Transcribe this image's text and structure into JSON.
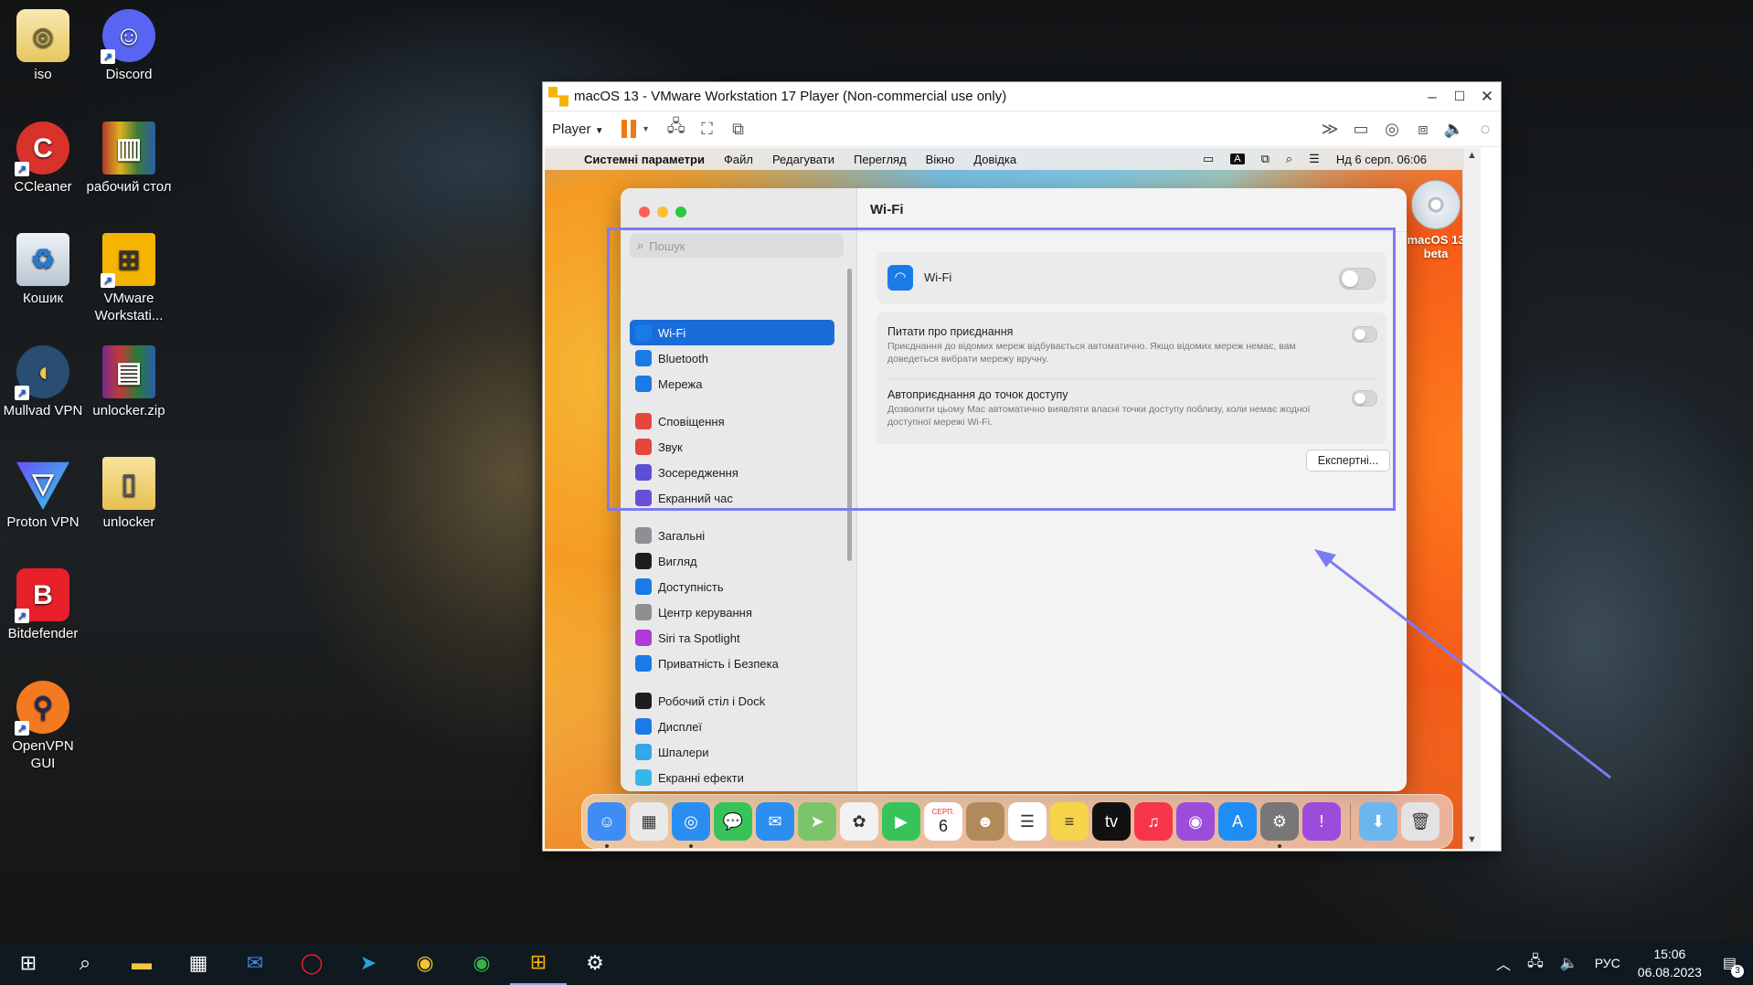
{
  "desktop": {
    "icons": [
      {
        "label": "iso",
        "icon": "iso-file-icon"
      },
      {
        "label": "Discord",
        "icon": "discord-icon"
      },
      {
        "label": "CCleaner",
        "icon": "ccleaner-icon"
      },
      {
        "label": "рабочий стол",
        "icon": "archive-icon"
      },
      {
        "label": "Кошик",
        "icon": "recycle-bin-icon"
      },
      {
        "label": "VMware Workstati...",
        "icon": "vmware-icon"
      },
      {
        "label": "Mullvad VPN",
        "icon": "mullvad-icon"
      },
      {
        "label": "unlocker.zip",
        "icon": "winrar-icon"
      },
      {
        "label": "Proton VPN",
        "icon": "proton-vpn-icon"
      },
      {
        "label": "unlocker",
        "icon": "folder-icon"
      },
      {
        "label": "Bitdefender",
        "icon": "bitdefender-icon"
      },
      {
        "label": "OpenVPN GUI",
        "icon": "openvpn-icon"
      }
    ]
  },
  "vmware": {
    "title": "macOS 13 - VMware Workstation 17 Player (Non-commercial use only)",
    "player_menu": "Player",
    "controls": {
      "minimize": "–",
      "maximize": "☐",
      "close": "✕"
    }
  },
  "macos": {
    "menubar": {
      "app": "Системні параметри",
      "items": [
        "Файл",
        "Редагувати",
        "Перегляд",
        "Вікно",
        "Довідка"
      ],
      "input_badge": "A",
      "datetime": "Нд 6 серп.  06:06"
    },
    "dvd_label": "macOS 13 beta",
    "settings": {
      "search_placeholder": "Пошук",
      "title": "Wi-Fi",
      "sidebar": [
        {
          "label": "Wi-Fi",
          "icon": "wifi-icon",
          "color": "#1a7be8",
          "selected": true
        },
        {
          "label": "Bluetooth",
          "icon": "bluetooth-icon",
          "color": "#1a7be8"
        },
        {
          "label": "Мережа",
          "icon": "globe-icon",
          "color": "#1a7be8"
        },
        {
          "gap": true
        },
        {
          "label": "Сповіщення",
          "icon": "bell-icon",
          "color": "#e8453c"
        },
        {
          "label": "Звук",
          "icon": "speaker-icon",
          "color": "#e8453c"
        },
        {
          "label": "Зосередження",
          "icon": "moon-icon",
          "color": "#5b4fd6"
        },
        {
          "label": "Екранний час",
          "icon": "hourglass-icon",
          "color": "#6a4fd6"
        },
        {
          "gap": true
        },
        {
          "label": "Загальні",
          "icon": "gear-icon",
          "color": "#8e8e93"
        },
        {
          "label": "Вигляд",
          "icon": "appearance-icon",
          "color": "#1d1d1f"
        },
        {
          "label": "Доступність",
          "icon": "accessibility-icon",
          "color": "#1a7be8"
        },
        {
          "label": "Центр керування",
          "icon": "control-center-icon",
          "color": "#8e8e93"
        },
        {
          "label": "Siri та Spotlight",
          "icon": "siri-icon",
          "color": "#b03ad6"
        },
        {
          "label": "Приватність і Безпека",
          "icon": "hand-icon",
          "color": "#1a7be8"
        },
        {
          "gap": true
        },
        {
          "label": "Робочий стіл і Dock",
          "icon": "dock-icon",
          "color": "#1d1d1f"
        },
        {
          "label": "Дисплеї",
          "icon": "display-icon",
          "color": "#1a7be8"
        },
        {
          "label": "Шпалери",
          "icon": "wallpaper-icon",
          "color": "#35a6e8"
        },
        {
          "label": "Екранні ефекти",
          "icon": "screensaver-icon",
          "color": "#35b8e8"
        }
      ],
      "wifi_label": "Wi-Fi",
      "wifi_enabled": false,
      "options": [
        {
          "title": "Питати про приєднання",
          "desc": "Приєднання до відомих мереж відбувається автоматично. Якщо відомих мереж немає, вам доведеться вибрати мережу вручну.",
          "enabled": false
        },
        {
          "title": "Автоприєднання до точок доступу",
          "desc": "Дозволити цьому Mac автоматично виявляти власні точки доступу поблизу, коли немає жодної доступної мережі Wi-Fi.",
          "enabled": false
        }
      ],
      "advanced_button": "Експертні..."
    },
    "dock": [
      {
        "name": "finder-icon",
        "color": "#3d8df5",
        "glyph": "☺",
        "running": true
      },
      {
        "name": "launchpad-icon",
        "color": "#e9e9e9",
        "glyph": "▦"
      },
      {
        "name": "safari-icon",
        "color": "#2a8ef0",
        "glyph": "◎",
        "running": true
      },
      {
        "name": "messages-icon",
        "color": "#36c35a",
        "glyph": "💬"
      },
      {
        "name": "mail-icon",
        "color": "#2b8ef0",
        "glyph": "✉"
      },
      {
        "name": "maps-icon",
        "color": "#7cc46a",
        "glyph": "➤"
      },
      {
        "name": "photos-icon",
        "color": "#f2f2f2",
        "glyph": "✿"
      },
      {
        "name": "facetime-icon",
        "color": "#36c35a",
        "glyph": "▶"
      },
      {
        "name": "calendar-icon",
        "color": "#ffffff",
        "glyph": "6"
      },
      {
        "name": "contacts-icon",
        "color": "#b08a5a",
        "glyph": "☻"
      },
      {
        "name": "reminders-icon",
        "color": "#ffffff",
        "glyph": "☰"
      },
      {
        "name": "notes-icon",
        "color": "#f7d44a",
        "glyph": "≡"
      },
      {
        "name": "apple-tv-icon",
        "color": "#111111",
        "glyph": "tv"
      },
      {
        "name": "music-icon",
        "color": "#f7354a",
        "glyph": "♫"
      },
      {
        "name": "podcasts-icon",
        "color": "#9b4cdb",
        "glyph": "◉"
      },
      {
        "name": "app-store-icon",
        "color": "#1e8ef5",
        "glyph": "A"
      },
      {
        "name": "system-settings-icon",
        "color": "#777777",
        "glyph": "⚙",
        "running": true
      },
      {
        "name": "feedback-icon",
        "color": "#9b4cdb",
        "glyph": "!"
      },
      {
        "separator": true
      },
      {
        "name": "downloads-folder-icon",
        "color": "#6cb6f0",
        "glyph": "⬇"
      },
      {
        "name": "trash-icon",
        "color": "#e3e3e3",
        "glyph": "🗑"
      }
    ],
    "calendar_month": "СЕРП."
  },
  "taskbar": {
    "language": "РУС",
    "time": "15:06",
    "date": "06.08.2023",
    "notifications": "3"
  },
  "colors": {
    "annotation": "#7c7bf3",
    "accent": "#1a6cd9"
  }
}
